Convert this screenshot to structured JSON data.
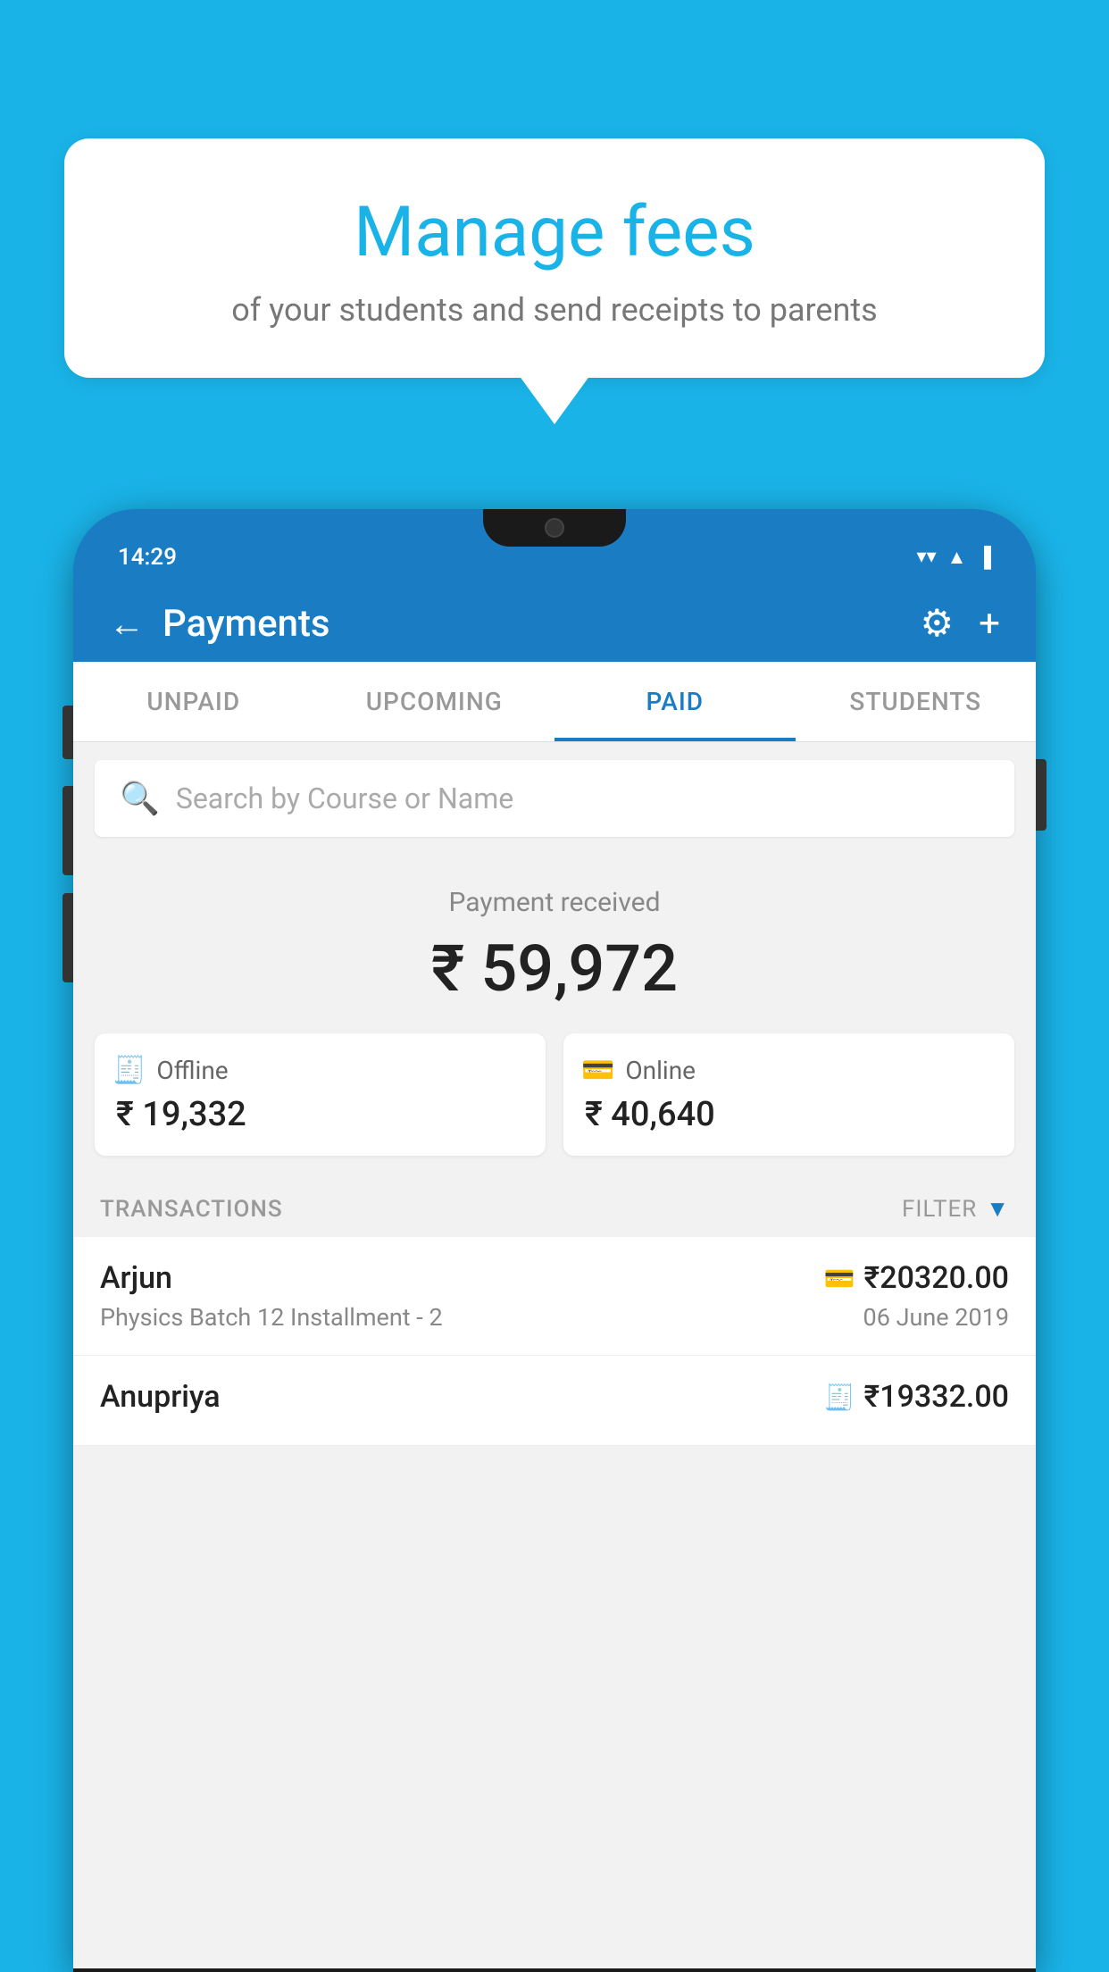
{
  "background_color": "#1ab3e8",
  "speech_bubble": {
    "title": "Manage fees",
    "subtitle": "of your students and send receipts to parents"
  },
  "status_bar": {
    "time": "14:29",
    "wifi": "▼",
    "signal": "▲",
    "battery": "▐"
  },
  "top_bar": {
    "title": "Payments",
    "back_label": "←",
    "gear_label": "⚙",
    "plus_label": "+"
  },
  "tabs": [
    {
      "label": "UNPAID",
      "active": false
    },
    {
      "label": "UPCOMING",
      "active": false
    },
    {
      "label": "PAID",
      "active": true
    },
    {
      "label": "STUDENTS",
      "active": false
    }
  ],
  "search": {
    "placeholder": "Search by Course or Name"
  },
  "payment_summary": {
    "label": "Payment received",
    "amount": "₹ 59,972"
  },
  "payment_cards": [
    {
      "type": "Offline",
      "amount": "₹ 19,332",
      "icon": "💳"
    },
    {
      "type": "Online",
      "amount": "₹ 40,640",
      "icon": "💳"
    }
  ],
  "transactions_header": {
    "label": "TRANSACTIONS",
    "filter_label": "FILTER",
    "filter_icon": "▼"
  },
  "transactions": [
    {
      "name": "Arjun",
      "course": "Physics Batch 12 Installment - 2",
      "amount": "₹20320.00",
      "date": "06 June 2019",
      "method_icon": "💳"
    },
    {
      "name": "Anupriya",
      "course": "",
      "amount": "₹19332.00",
      "date": "",
      "method_icon": "💳"
    }
  ]
}
